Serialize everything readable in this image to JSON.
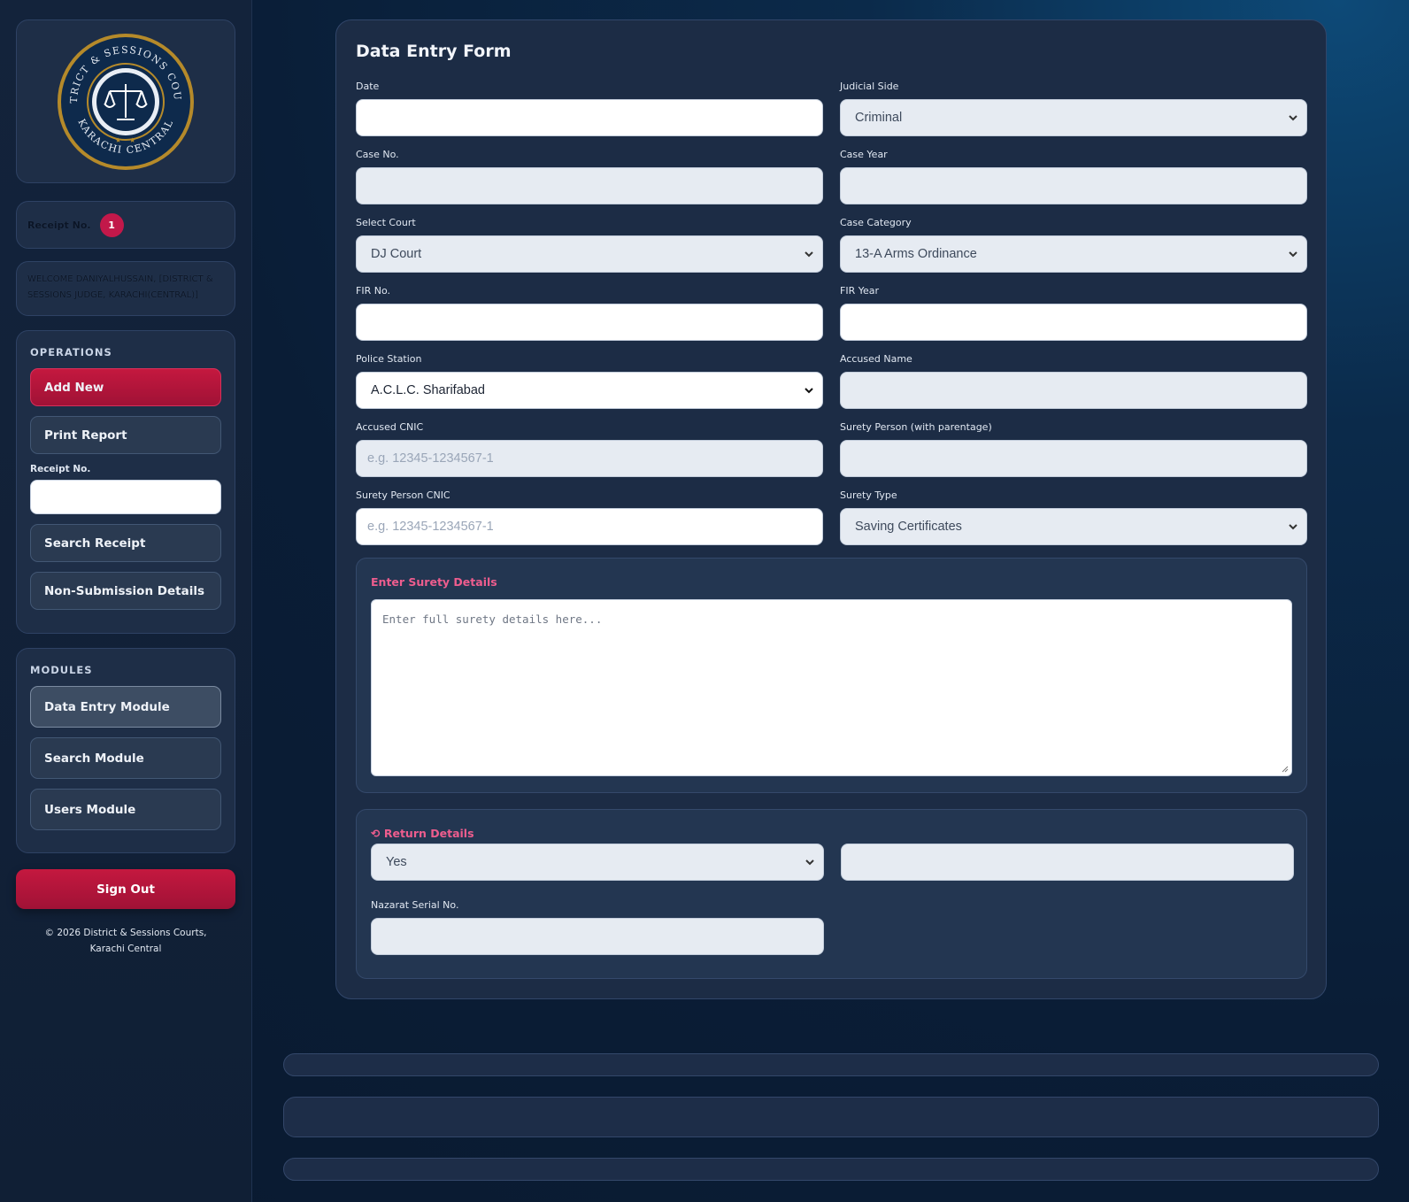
{
  "sidebar": {
    "logo": {
      "top_text": "DISTRICT & SESSIONS COURTS",
      "bottom_text": "KARACHI CENTRAL"
    },
    "receipt": {
      "label": "Receipt No.",
      "count": "1"
    },
    "welcome": "WELCOME DANIYALHUSSAIN, [DISTRICT & SESSIONS JUDGE, KARACHI(CENTRAL)]",
    "operations": {
      "title": "OPERATIONS",
      "add_new": "Add New",
      "print_report": "Print Report",
      "receipt_label": "Receipt No.",
      "receipt_value": "",
      "search_receipt": "Search Receipt",
      "non_submission": "Non-Submission Details"
    },
    "modules": {
      "title": "MODULES",
      "data_entry": "Data Entry Module",
      "search": "Search Module",
      "users": "Users Module"
    },
    "sign_out": "Sign Out",
    "copyright_line1": "© 2026 District & Sessions Courts,",
    "copyright_line2": "Karachi Central"
  },
  "form": {
    "title": "Data Entry Form",
    "date": {
      "label": "Date",
      "value": ""
    },
    "judicial_side": {
      "label": "Judicial Side",
      "value": "Criminal"
    },
    "case_no": {
      "label": "Case No.",
      "value": ""
    },
    "case_year": {
      "label": "Case Year",
      "value": ""
    },
    "select_court": {
      "label": "Select Court",
      "value": "DJ Court"
    },
    "case_category": {
      "label": "Case Category",
      "value": "13-A Arms Ordinance"
    },
    "fir_no": {
      "label": "FIR No.",
      "value": ""
    },
    "fir_year": {
      "label": "FIR Year",
      "value": ""
    },
    "police_station": {
      "label": "Police Station",
      "value": "A.C.L.C. Sharifabad"
    },
    "accused_name": {
      "label": "Accused Name",
      "value": ""
    },
    "accused_cnic": {
      "label": "Accused CNIC",
      "placeholder": "e.g. 12345-1234567-1"
    },
    "surety_person": {
      "label": "Surety Person (with parentage)",
      "value": ""
    },
    "surety_cnic": {
      "label": "Surety Person CNIC",
      "placeholder": "e.g. 12345-1234567-1"
    },
    "surety_type": {
      "label": "Surety Type",
      "value": "Saving Certificates"
    },
    "surety_details": {
      "title": "Enter Surety Details",
      "placeholder": "Enter full surety details here..."
    },
    "return_details": {
      "title": "Return Details",
      "returned": "Yes",
      "return_info": "",
      "nazarat_label": "Nazarat Serial No.",
      "nazarat_value": ""
    }
  },
  "colors": {
    "accent": "#c4183f",
    "panel_title": "#ee5d8e",
    "background": "#0a1d36"
  }
}
